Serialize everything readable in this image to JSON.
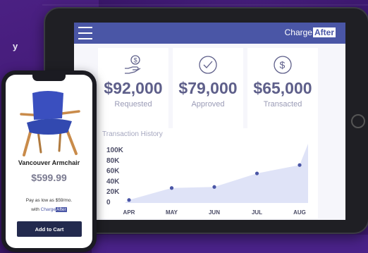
{
  "left_fragment": "y",
  "tablet": {
    "brand": {
      "charge": "Charge",
      "after": "After"
    },
    "stats": [
      {
        "icon": "hand-dollar-icon",
        "value": "$92,000",
        "label": "Requested"
      },
      {
        "icon": "check-circle-icon",
        "value": "$79,000",
        "label": "Approved"
      },
      {
        "icon": "dollar-circle-icon",
        "value": "$65,000",
        "label": "Transacted"
      }
    ],
    "chart_title": "Transaction History"
  },
  "chart_data": {
    "type": "area",
    "title": "Transaction History",
    "categories": [
      "APR",
      "MAY",
      "JUN",
      "JUL",
      "AUG"
    ],
    "y_ticks": [
      "0",
      "20K",
      "40K",
      "60K",
      "80K",
      "100K"
    ],
    "ylim": [
      0,
      100000
    ],
    "series": [
      {
        "values": [
          3000,
          26000,
          28000,
          54000,
          70000
        ]
      }
    ],
    "colors": {
      "area": "#dfe3f7",
      "point": "#4a56a6"
    },
    "grid": false
  },
  "phone": {
    "product_name": "Vancouver Armchair",
    "price": "$599.99",
    "pay_text": "Pay as low as $59/mo.",
    "with_text": "with",
    "brand_charge": "Charge",
    "brand_after": "After",
    "button_label": "Add to Cart"
  },
  "colors": {
    "brand": "#4a56a6",
    "background": "#3f1973",
    "cart_button": "#232a4e"
  }
}
